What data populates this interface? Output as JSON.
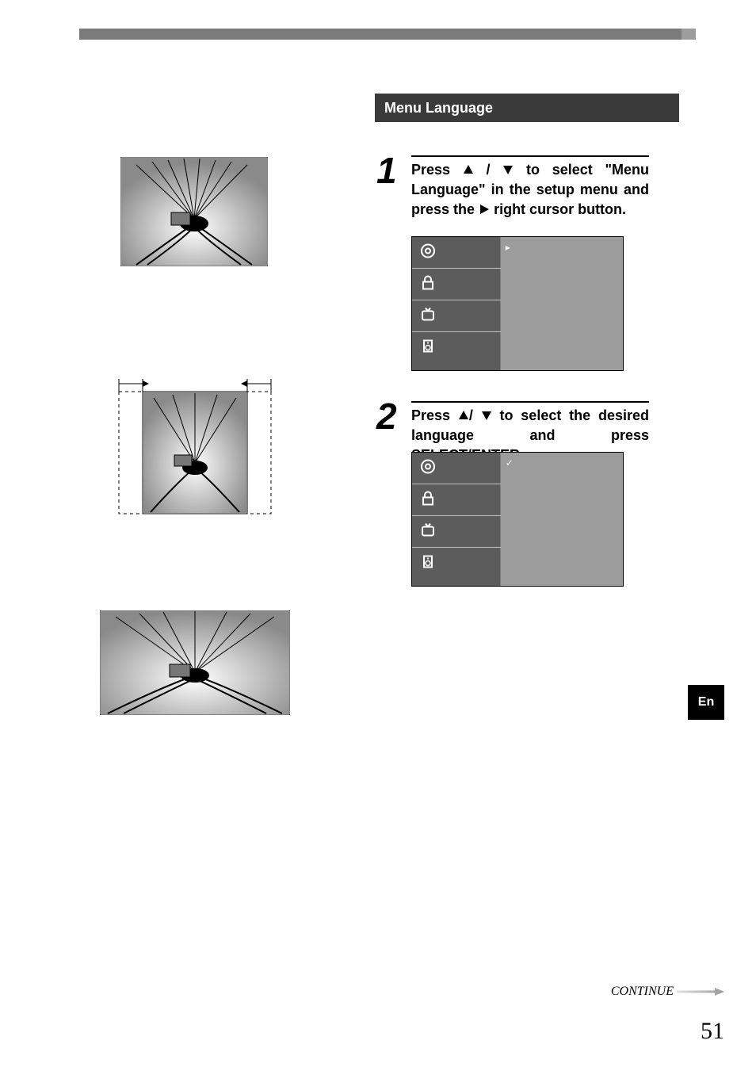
{
  "topbar": {},
  "section": {
    "title": "Menu Language"
  },
  "steps": [
    {
      "num": "1",
      "text_before": "Press ",
      "text_middle": " to select \"Menu Language\" in the setup menu and press the ",
      "text_after": " right cursor button."
    },
    {
      "num": "2",
      "text_before": "Press ",
      "text_middle": " to select the desired language and press SELECT/ENTER.",
      "text_after": ""
    }
  ],
  "menu": {
    "mark_step1": "▸",
    "mark_step2": "✓",
    "icons": [
      "disc-icon",
      "lock-icon",
      "tv-icon",
      "speaker-icon"
    ]
  },
  "lang_tab": "En",
  "continue_label": "CONTINUE",
  "page_number": "51"
}
